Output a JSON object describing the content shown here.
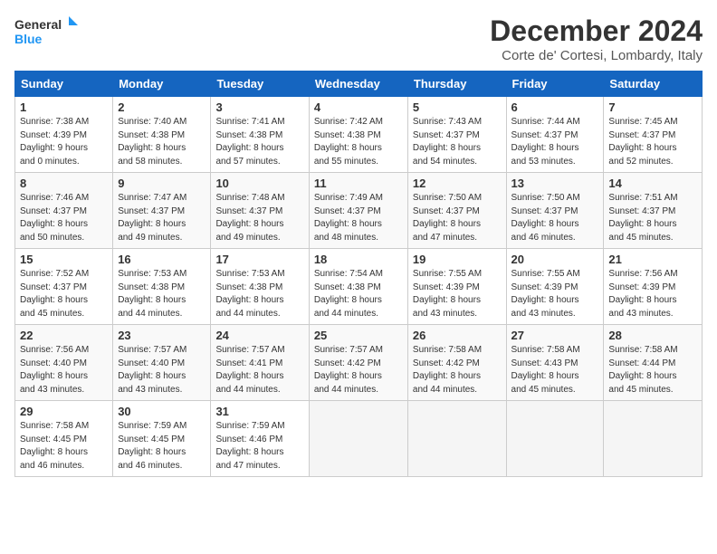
{
  "logo": {
    "line1": "General",
    "line2": "Blue"
  },
  "title": "December 2024",
  "subtitle": "Corte de' Cortesi, Lombardy, Italy",
  "weekdays": [
    "Sunday",
    "Monday",
    "Tuesday",
    "Wednesday",
    "Thursday",
    "Friday",
    "Saturday"
  ],
  "weeks": [
    [
      {
        "day": 1,
        "info": "Sunrise: 7:38 AM\nSunset: 4:39 PM\nDaylight: 9 hours\nand 0 minutes."
      },
      {
        "day": 2,
        "info": "Sunrise: 7:40 AM\nSunset: 4:38 PM\nDaylight: 8 hours\nand 58 minutes."
      },
      {
        "day": 3,
        "info": "Sunrise: 7:41 AM\nSunset: 4:38 PM\nDaylight: 8 hours\nand 57 minutes."
      },
      {
        "day": 4,
        "info": "Sunrise: 7:42 AM\nSunset: 4:38 PM\nDaylight: 8 hours\nand 55 minutes."
      },
      {
        "day": 5,
        "info": "Sunrise: 7:43 AM\nSunset: 4:37 PM\nDaylight: 8 hours\nand 54 minutes."
      },
      {
        "day": 6,
        "info": "Sunrise: 7:44 AM\nSunset: 4:37 PM\nDaylight: 8 hours\nand 53 minutes."
      },
      {
        "day": 7,
        "info": "Sunrise: 7:45 AM\nSunset: 4:37 PM\nDaylight: 8 hours\nand 52 minutes."
      }
    ],
    [
      {
        "day": 8,
        "info": "Sunrise: 7:46 AM\nSunset: 4:37 PM\nDaylight: 8 hours\nand 50 minutes."
      },
      {
        "day": 9,
        "info": "Sunrise: 7:47 AM\nSunset: 4:37 PM\nDaylight: 8 hours\nand 49 minutes."
      },
      {
        "day": 10,
        "info": "Sunrise: 7:48 AM\nSunset: 4:37 PM\nDaylight: 8 hours\nand 49 minutes."
      },
      {
        "day": 11,
        "info": "Sunrise: 7:49 AM\nSunset: 4:37 PM\nDaylight: 8 hours\nand 48 minutes."
      },
      {
        "day": 12,
        "info": "Sunrise: 7:50 AM\nSunset: 4:37 PM\nDaylight: 8 hours\nand 47 minutes."
      },
      {
        "day": 13,
        "info": "Sunrise: 7:50 AM\nSunset: 4:37 PM\nDaylight: 8 hours\nand 46 minutes."
      },
      {
        "day": 14,
        "info": "Sunrise: 7:51 AM\nSunset: 4:37 PM\nDaylight: 8 hours\nand 45 minutes."
      }
    ],
    [
      {
        "day": 15,
        "info": "Sunrise: 7:52 AM\nSunset: 4:37 PM\nDaylight: 8 hours\nand 45 minutes."
      },
      {
        "day": 16,
        "info": "Sunrise: 7:53 AM\nSunset: 4:38 PM\nDaylight: 8 hours\nand 44 minutes."
      },
      {
        "day": 17,
        "info": "Sunrise: 7:53 AM\nSunset: 4:38 PM\nDaylight: 8 hours\nand 44 minutes."
      },
      {
        "day": 18,
        "info": "Sunrise: 7:54 AM\nSunset: 4:38 PM\nDaylight: 8 hours\nand 44 minutes."
      },
      {
        "day": 19,
        "info": "Sunrise: 7:55 AM\nSunset: 4:39 PM\nDaylight: 8 hours\nand 43 minutes."
      },
      {
        "day": 20,
        "info": "Sunrise: 7:55 AM\nSunset: 4:39 PM\nDaylight: 8 hours\nand 43 minutes."
      },
      {
        "day": 21,
        "info": "Sunrise: 7:56 AM\nSunset: 4:39 PM\nDaylight: 8 hours\nand 43 minutes."
      }
    ],
    [
      {
        "day": 22,
        "info": "Sunrise: 7:56 AM\nSunset: 4:40 PM\nDaylight: 8 hours\nand 43 minutes."
      },
      {
        "day": 23,
        "info": "Sunrise: 7:57 AM\nSunset: 4:40 PM\nDaylight: 8 hours\nand 43 minutes."
      },
      {
        "day": 24,
        "info": "Sunrise: 7:57 AM\nSunset: 4:41 PM\nDaylight: 8 hours\nand 44 minutes."
      },
      {
        "day": 25,
        "info": "Sunrise: 7:57 AM\nSunset: 4:42 PM\nDaylight: 8 hours\nand 44 minutes."
      },
      {
        "day": 26,
        "info": "Sunrise: 7:58 AM\nSunset: 4:42 PM\nDaylight: 8 hours\nand 44 minutes."
      },
      {
        "day": 27,
        "info": "Sunrise: 7:58 AM\nSunset: 4:43 PM\nDaylight: 8 hours\nand 45 minutes."
      },
      {
        "day": 28,
        "info": "Sunrise: 7:58 AM\nSunset: 4:44 PM\nDaylight: 8 hours\nand 45 minutes."
      }
    ],
    [
      {
        "day": 29,
        "info": "Sunrise: 7:58 AM\nSunset: 4:45 PM\nDaylight: 8 hours\nand 46 minutes."
      },
      {
        "day": 30,
        "info": "Sunrise: 7:59 AM\nSunset: 4:45 PM\nDaylight: 8 hours\nand 46 minutes."
      },
      {
        "day": 31,
        "info": "Sunrise: 7:59 AM\nSunset: 4:46 PM\nDaylight: 8 hours\nand 47 minutes."
      },
      null,
      null,
      null,
      null
    ]
  ]
}
